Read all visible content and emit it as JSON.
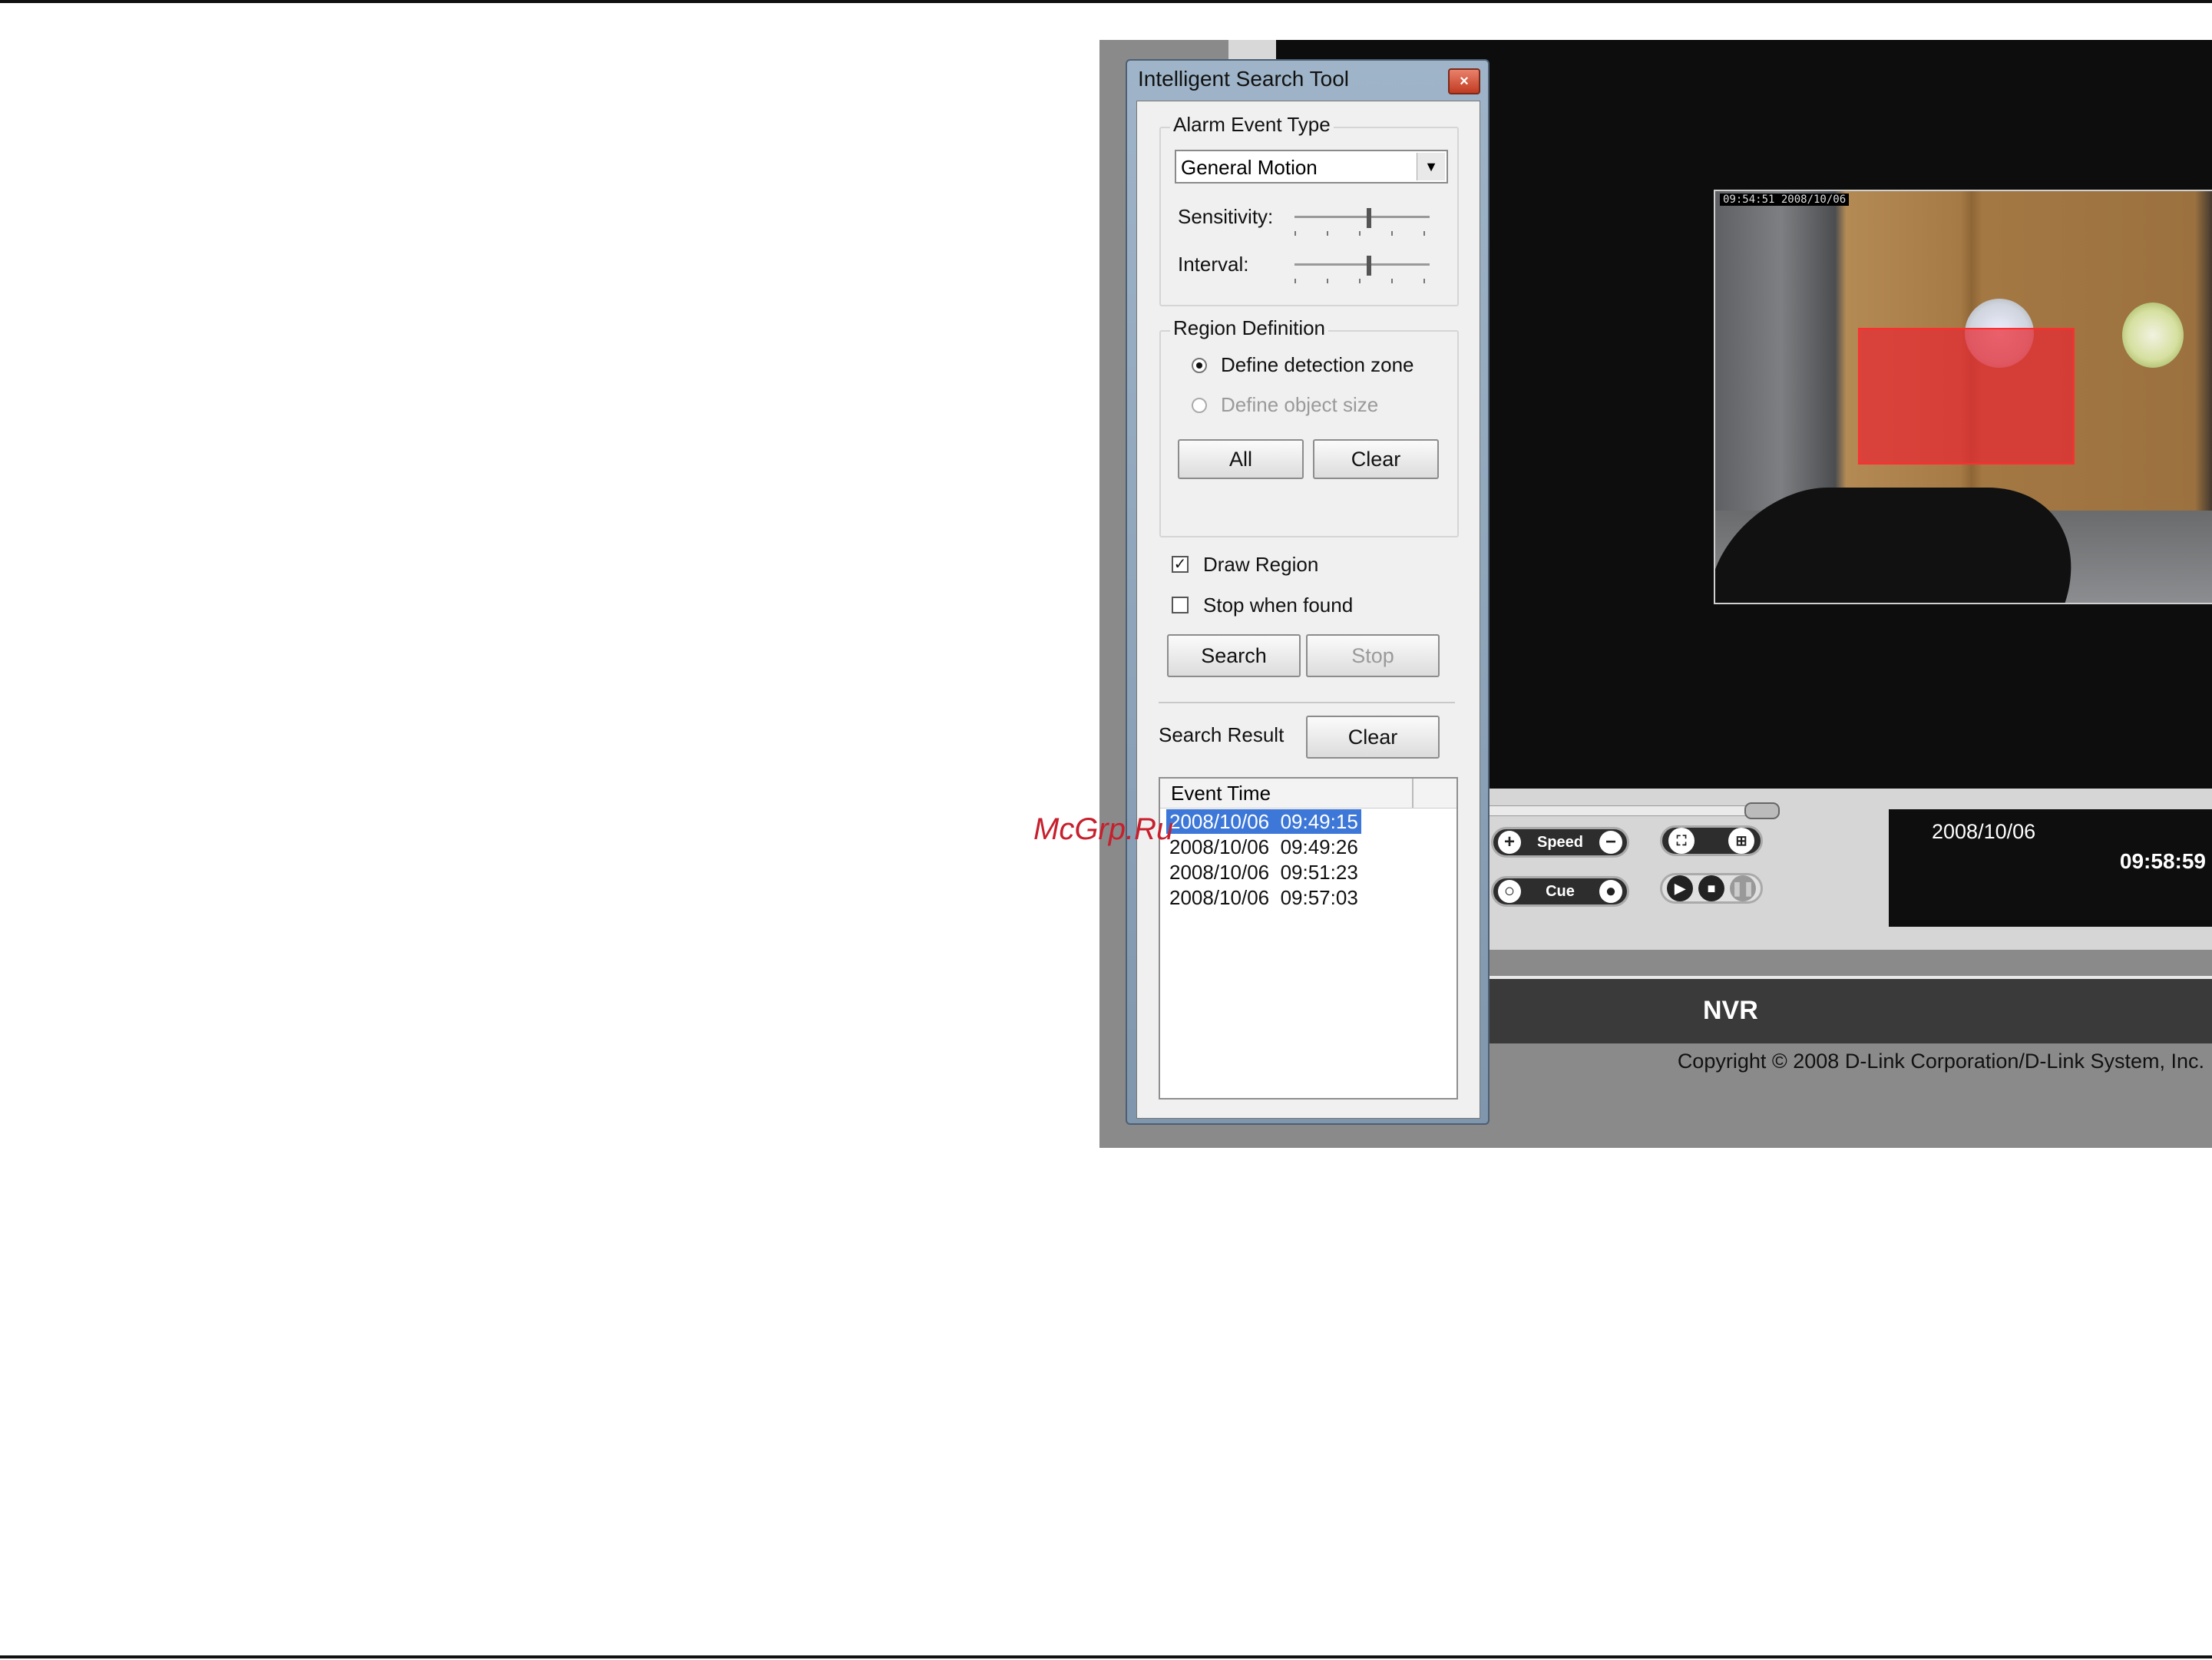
{
  "dialog": {
    "title": "Intelligent Search Tool",
    "close_glyph": "×",
    "alarm_group": {
      "legend": "Alarm Event Type",
      "event_type_value": "General Motion",
      "sensitivity_label": "Sensitivity:",
      "interval_label": "Interval:",
      "sensitivity_level": 0.55,
      "interval_level": 0.55
    },
    "region_group": {
      "legend": "Region Definition",
      "radio_zone_label": "Define detection zone",
      "radio_zone_selected": true,
      "radio_size_label": "Define object size",
      "radio_size_enabled": false,
      "all_button": "All",
      "clear_button": "Clear"
    },
    "draw_region_label": "Draw Region",
    "draw_region_checked": true,
    "stop_when_found_label": "Stop when found",
    "stop_when_found_checked": false,
    "search_button": "Search",
    "stop_button": "Stop",
    "search_result_label": "Search Result",
    "result_clear_button": "Clear",
    "results": {
      "column_header": "Event Time",
      "rows": [
        "2008/10/06  09:49:15",
        "2008/10/06  09:49:26",
        "2008/10/06  09:51:23",
        "2008/10/06  09:57:03"
      ],
      "selected_index": 0
    }
  },
  "viewer": {
    "video_timestamp": "09:54:51  2008/10/06"
  },
  "player": {
    "speed_label": "Speed",
    "cue_label": "Cue",
    "date": "2008/10/06",
    "time": "09:58:59"
  },
  "app": {
    "product_name": "NVR",
    "copyright": "Copyright © 2008 D-Link Corporation/D-Link System, Inc."
  },
  "watermark": "McGrp.Ru",
  "colors": {
    "selection": "#3d78d8",
    "detection_region": "#e82832",
    "close_button": "#c13a21"
  }
}
